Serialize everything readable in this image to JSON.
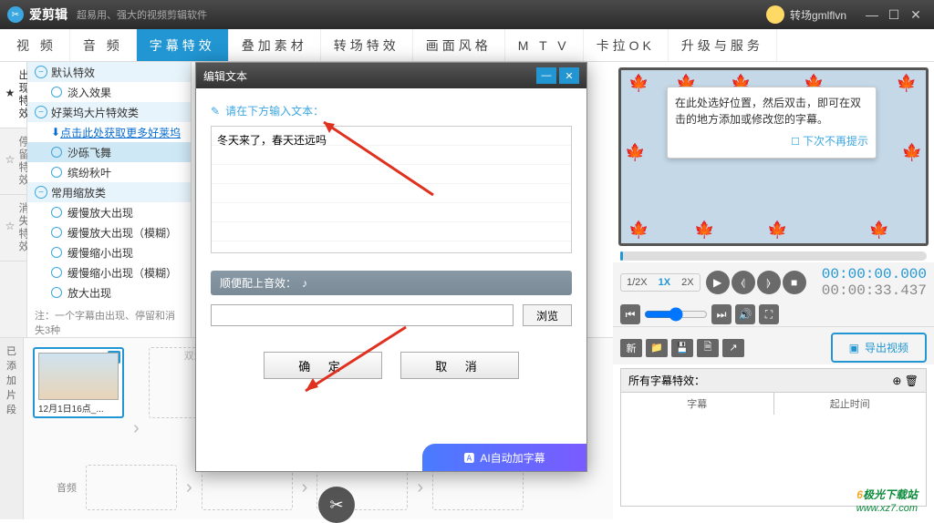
{
  "titlebar": {
    "app": "爱剪辑",
    "slogan": "超易用、强大的视频剪辑软件",
    "user": "转场gmlflvn"
  },
  "tabs": [
    "视  频",
    "音  频",
    "字幕特效",
    "叠加素材",
    "转场特效",
    "画面风格",
    "M T V",
    "卡拉OK",
    "升级与服务"
  ],
  "activeTab": 2,
  "sidetabs": [
    "出现特效",
    "停留特效",
    "消失特效"
  ],
  "effects": {
    "g1": {
      "name": "默认特效",
      "items": [
        "淡入效果"
      ]
    },
    "g2": {
      "name": "好莱坞大片特效类",
      "link": "点击此处获取更多好莱坞",
      "items": [
        "沙砾飞舞",
        "缤纷秋叶"
      ]
    },
    "g3": {
      "name": "常用缩放类",
      "items": [
        "缓慢放大出现",
        "缓慢放大出现（模糊）",
        "缓慢缩小出现",
        "缓慢缩小出现（模糊）",
        "放大出现"
      ]
    }
  },
  "note": "注：一个字幕由出现、停留和消失3种",
  "dialog": {
    "title": "编辑文本",
    "inputLabel": "请在下方输入文本：",
    "text": "冬天来了，春天还远吗",
    "soundLabel": "顺便配上音效：",
    "browse": "浏览",
    "ok": "确 定",
    "cancel": "取 消",
    "ai": "AI自动加字幕"
  },
  "preview": {
    "tip": "在此处选好位置，然后双击，即可在双击的地方添加或修改您的字幕。",
    "checkbox": "下次不再提示"
  },
  "speeds": [
    "1/2X",
    "1X",
    "2X"
  ],
  "time": {
    "cur": "00:00:00.000",
    "dur": "00:00:33.437"
  },
  "toolbar": {
    "new": "新",
    "export": "导出视频"
  },
  "subtable": {
    "title": "所有字幕特效：",
    "col1": "字幕",
    "col2": "起止时间"
  },
  "bottom": {
    "tab": "已添加片段",
    "clipName": "12月1日16点_...",
    "doubleAdd": "双添",
    "audio": "音频"
  },
  "watermark": {
    "l1": "极光下载站",
    "l2": "www.xz7.com"
  }
}
